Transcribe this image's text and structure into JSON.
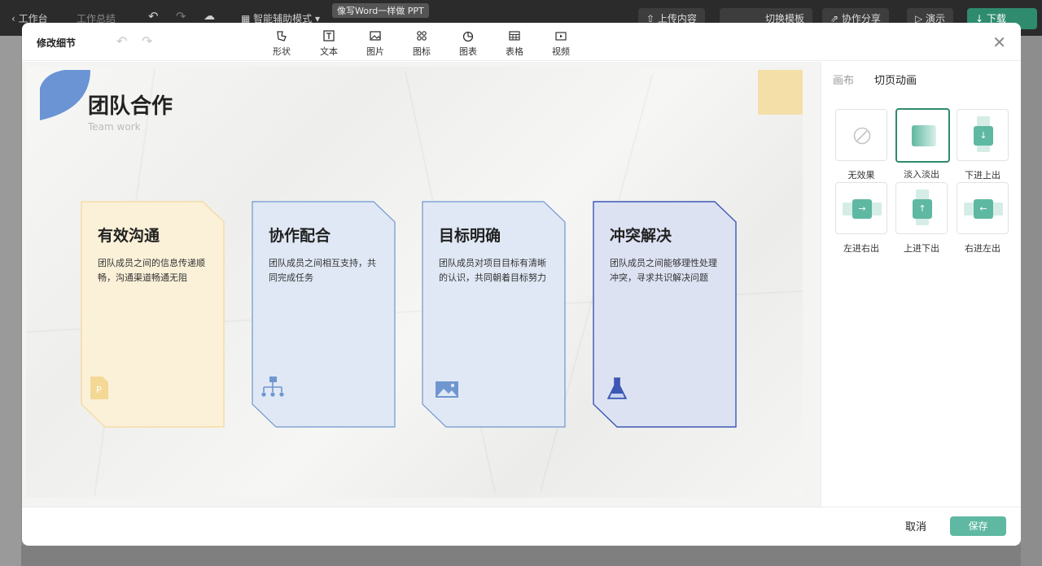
{
  "background_app": {
    "back_label": "工作台",
    "doc_title": "工作总结",
    "mode_label": "智能辅助模式",
    "tooltip": "像写Word一样做 PPT",
    "upload_label": "上传内容",
    "template_label": "切换模板",
    "share_label": "协作分享",
    "present_label": "演示",
    "download_label": "下载"
  },
  "modal": {
    "title": "修改细节",
    "toolbar": [
      {
        "label": "形状",
        "icon": "shape-icon"
      },
      {
        "label": "文本",
        "icon": "text-icon"
      },
      {
        "label": "图片",
        "icon": "image-icon"
      },
      {
        "label": "图标",
        "icon": "icons-icon"
      },
      {
        "label": "图表",
        "icon": "chart-icon"
      },
      {
        "label": "表格",
        "icon": "table-icon"
      },
      {
        "label": "视频",
        "icon": "video-icon"
      }
    ],
    "cancel_label": "取消",
    "save_label": "保存"
  },
  "slide": {
    "title": "团队合作",
    "subtitle": "Team work",
    "cards": [
      {
        "title": "有效沟通",
        "body": "团队成员之间的信息传递顺畅，沟通渠道畅通无阻",
        "icon": "document-icon",
        "fill": "#fbf1d8",
        "stroke": "#f5d79a"
      },
      {
        "title": "协作配合",
        "body": "团队成员之间相互支持，共同完成任务",
        "icon": "org-chart-icon",
        "fill": "#e0e8f5",
        "stroke": "#6f96cf"
      },
      {
        "title": "目标明确",
        "body": "团队成员对项目目标有清晰的认识，共同朝着目标努力",
        "icon": "picture-icon",
        "fill": "#e0e8f5",
        "stroke": "#6f96cf"
      },
      {
        "title": "冲突解决",
        "body": "团队成员之间能够理性处理冲突，寻求共识解决问题",
        "icon": "flask-icon",
        "fill": "#dde2f3",
        "stroke": "#3c57b4"
      }
    ]
  },
  "panel": {
    "tabs": [
      "画布",
      "切页动画"
    ],
    "active_tab": "切页动画",
    "animations": [
      {
        "label": "无效果",
        "selected": false
      },
      {
        "label": "淡入淡出",
        "selected": true
      },
      {
        "label": "下进上出",
        "selected": false
      },
      {
        "label": "左进右出",
        "selected": false
      },
      {
        "label": "上进下出",
        "selected": false
      },
      {
        "label": "右进左出",
        "selected": false
      }
    ]
  },
  "colors": {
    "accent": "#2e8b6e",
    "save_button": "#5fb8a1",
    "yellow_square": "#f5dfa8",
    "title_shape": "#5b8ad0"
  }
}
